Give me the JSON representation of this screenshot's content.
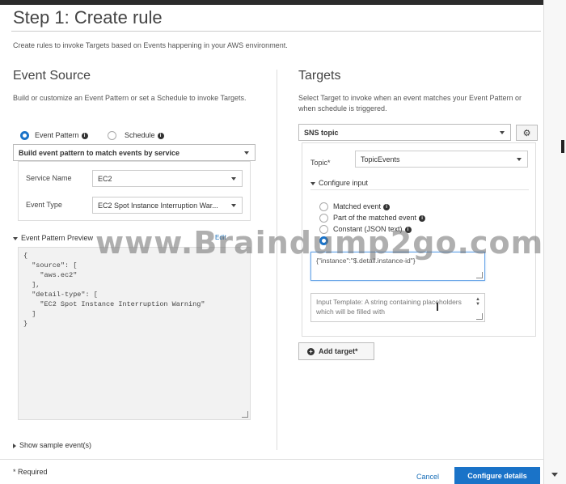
{
  "page": {
    "title": "Step 1: Create rule",
    "subtitle": "Create rules to invoke Targets based on Events happening in your AWS environment."
  },
  "event_source": {
    "heading": "Event Source",
    "description": "Build or customize an Event Pattern or set a Schedule to invoke Targets.",
    "radio_event_pattern": "Event Pattern",
    "radio_schedule": "Schedule",
    "pattern_mode_select": "Build event pattern to match events by service",
    "service_name_label": "Service Name",
    "service_name_value": "EC2",
    "event_type_label": "Event Type",
    "event_type_value": "EC2 Spot Instance Interruption War...",
    "preview_label": "Event Pattern Preview",
    "edit_link": "Edit",
    "code_lines": [
      "{",
      "  \"source\": [",
      "    \"aws.ec2\"",
      "  ],",
      "  \"detail-type\": [",
      "    \"EC2 Spot Instance Interruption Warning\"",
      "  ]",
      "}"
    ],
    "show_sample": "Show sample event(s)"
  },
  "targets": {
    "heading": "Targets",
    "description": "Select Target to invoke when an event matches your Event Pattern or when schedule is triggered.",
    "target_type": "SNS topic",
    "topic_label": "Topic*",
    "topic_value": "TopicEvents",
    "configure_input": "Configure input",
    "opt_matched": "Matched event",
    "opt_part": "Part of the matched event",
    "opt_constant": "Constant (JSON text)",
    "input_path_value": "{\"instance\":\"$.detail.instance-id\"}",
    "input_template_placeholder": "Input Template: A string containing placeholders which will be filled with",
    "add_target": "Add target*"
  },
  "footer": {
    "required": "* Required",
    "cancel": "Cancel",
    "configure_details": "Configure details"
  },
  "watermark": "www.Braindump2go.com",
  "colors": {
    "primary": "#1a73c8",
    "link": "#1a6fb8"
  }
}
